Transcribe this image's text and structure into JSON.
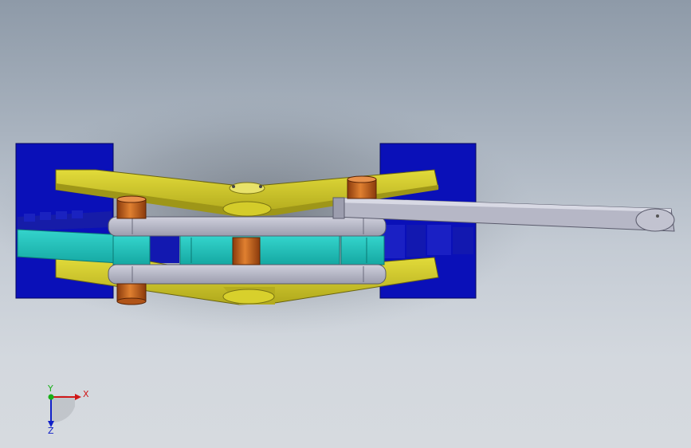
{
  "viewport": {
    "background_top": "#8e9aa8",
    "background_bottom": "#d6dadf"
  },
  "model": {
    "parts": [
      {
        "name": "base-block",
        "color": "#0a10b8",
        "count": 2
      },
      {
        "name": "yellow-link",
        "color": "#cfc628",
        "count": 2
      },
      {
        "name": "gray-link",
        "color": "#a8a9b8",
        "count": 3
      },
      {
        "name": "teal-link",
        "color": "#1fc2bb",
        "count": 1
      },
      {
        "name": "bronze-pin",
        "color": "#c8641c",
        "count": 4
      }
    ]
  },
  "triad": {
    "x_label": "X",
    "y_label": "Y",
    "z_label": "Z",
    "x_color": "#d01818",
    "y_color": "#18b018",
    "z_color": "#1020c8"
  }
}
